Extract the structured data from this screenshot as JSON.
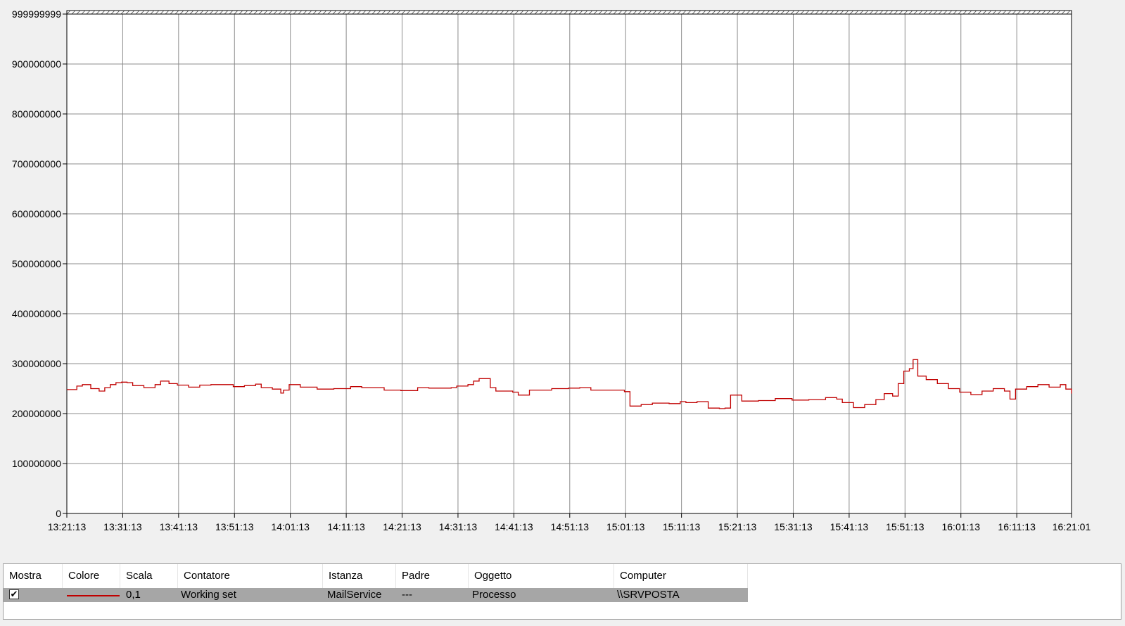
{
  "chart_data": {
    "type": "line",
    "ylim": [
      0,
      999999999
    ],
    "y_ticks": [
      "0",
      "100000000",
      "200000000",
      "300000000",
      "400000000",
      "500000000",
      "600000000",
      "700000000",
      "800000000",
      "900000000",
      "999999999"
    ],
    "y_tick_values": [
      0,
      100000000,
      200000000,
      300000000,
      400000000,
      500000000,
      600000000,
      700000000,
      800000000,
      900000000,
      999999999
    ],
    "x_ticks": [
      "13:21:13",
      "13:31:13",
      "13:41:13",
      "13:51:13",
      "14:01:13",
      "14:11:13",
      "14:21:13",
      "14:31:13",
      "14:41:13",
      "14:51:13",
      "15:01:13",
      "15:11:13",
      "15:21:13",
      "15:31:13",
      "15:41:13",
      "15:51:13",
      "16:01:13",
      "16:11:13",
      "16:21:01"
    ],
    "grid": true,
    "series": [
      {
        "color": "#c00000",
        "x": [
          "13:21:13",
          "13:23:00",
          "13:24:00",
          "13:25:30",
          "13:27:00",
          "13:28:00",
          "13:29:00",
          "13:30:00",
          "13:31:00",
          "13:32:00",
          "13:33:00",
          "13:35:00",
          "13:37:00",
          "13:38:00",
          "13:39:30",
          "13:41:00",
          "13:43:00",
          "13:45:00",
          "13:47:00",
          "13:50:00",
          "13:51:00",
          "13:53:00",
          "13:55:00",
          "13:56:00",
          "13:58:00",
          "13:59:30",
          "14:00:00",
          "14:01:00",
          "14:03:00",
          "14:06:00",
          "14:09:00",
          "14:12:00",
          "14:14:00",
          "14:18:00",
          "14:21:00",
          "14:24:00",
          "14:26:00",
          "14:30:00",
          "14:31:00",
          "14:33:00",
          "14:34:00",
          "14:35:00",
          "14:37:00",
          "14:38:00",
          "14:41:00",
          "14:42:00",
          "14:44:00",
          "14:48:00",
          "14:51:00",
          "14:53:00",
          "14:55:00",
          "15:00:00",
          "15:01:00",
          "15:02:00",
          "15:04:00",
          "15:06:00",
          "15:09:00",
          "15:11:00",
          "15:12:00",
          "15:14:00",
          "15:16:00",
          "15:18:00",
          "15:19:00",
          "15:20:00",
          "15:22:00",
          "15:25:00",
          "15:28:00",
          "15:31:00",
          "15:34:00",
          "15:37:00",
          "15:39:00",
          "15:40:00",
          "15:42:00",
          "15:44:00",
          "15:46:00",
          "15:47:30",
          "15:49:00",
          "15:50:00",
          "15:51:00",
          "15:52:00",
          "15:52:40",
          "15:53:30",
          "15:55:00",
          "15:57:00",
          "15:59:00",
          "16:01:00",
          "16:03:00",
          "16:05:00",
          "16:07:00",
          "16:09:00",
          "16:10:00",
          "16:11:00",
          "16:13:00",
          "16:15:00",
          "16:17:00",
          "16:19:00",
          "16:20:00",
          "16:21:01"
        ],
        "values": [
          248000000,
          255000000,
          258000000,
          250000000,
          245000000,
          252000000,
          258000000,
          262000000,
          263000000,
          262000000,
          256000000,
          252000000,
          258000000,
          265000000,
          260000000,
          257000000,
          253000000,
          257000000,
          258000000,
          258000000,
          254000000,
          256000000,
          259000000,
          252000000,
          249000000,
          241000000,
          247000000,
          258000000,
          253000000,
          249000000,
          250000000,
          254000000,
          252000000,
          247000000,
          246000000,
          252000000,
          251000000,
          252000000,
          255000000,
          258000000,
          265000000,
          270000000,
          252000000,
          245000000,
          243000000,
          237000000,
          247000000,
          250000000,
          251000000,
          252000000,
          247000000,
          247000000,
          244000000,
          215000000,
          218000000,
          221000000,
          220000000,
          224000000,
          222000000,
          224000000,
          211000000,
          210000000,
          211000000,
          237000000,
          225000000,
          226000000,
          230000000,
          227000000,
          228000000,
          232000000,
          229000000,
          222000000,
          212000000,
          218000000,
          228000000,
          240000000,
          235000000,
          260000000,
          285000000,
          290000000,
          308000000,
          275000000,
          268000000,
          260000000,
          250000000,
          243000000,
          238000000,
          245000000,
          250000000,
          245000000,
          229000000,
          249000000,
          254000000,
          258000000,
          253000000,
          258000000,
          249000000,
          240000000
        ]
      }
    ]
  },
  "table": {
    "headers": [
      "Mostra",
      "Colore",
      "Scala",
      "Contatore",
      "Istanza",
      "Padre",
      "Oggetto",
      "Computer"
    ],
    "row": {
      "checked": "✔",
      "scale": "0,1",
      "counter": "Working set",
      "instance": "MailService",
      "parent": "---",
      "object": "Processo",
      "computer": "\\\\SRVPOSTA"
    }
  }
}
